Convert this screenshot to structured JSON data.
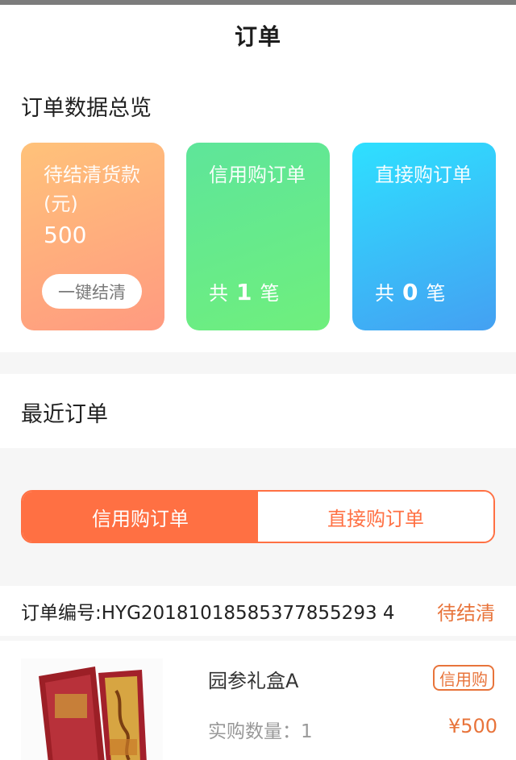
{
  "header": {
    "title": "订单"
  },
  "overview": {
    "title": "订单数据总览",
    "cards": [
      {
        "label": "待结清货款",
        "unit": "(元)",
        "amount": "500",
        "action_label": "一键结清"
      },
      {
        "label": "信用购订单",
        "count_prefix": "共",
        "count": "1",
        "count_suffix": "笔"
      },
      {
        "label": "直接购订单",
        "count_prefix": "共",
        "count": "0",
        "count_suffix": "笔"
      }
    ]
  },
  "recent": {
    "title": "最近订单"
  },
  "tabs": [
    {
      "label": "信用购订单",
      "active": true
    },
    {
      "label": "直接购订单",
      "active": false
    }
  ],
  "order": {
    "number_label": "订单编号:",
    "number": "HYG20181018585377855293 4",
    "status": "待结清",
    "product": {
      "name": "园参礼盒A",
      "tag": "信用购",
      "qty_label": "实购数量：",
      "qty": "1",
      "price": "¥500"
    }
  },
  "colors": {
    "accent": "#ff7043",
    "status_text": "#e8743b",
    "card_orange": "#ffb07c",
    "card_green": "#62e88a",
    "card_blue": "#38c6fb"
  }
}
